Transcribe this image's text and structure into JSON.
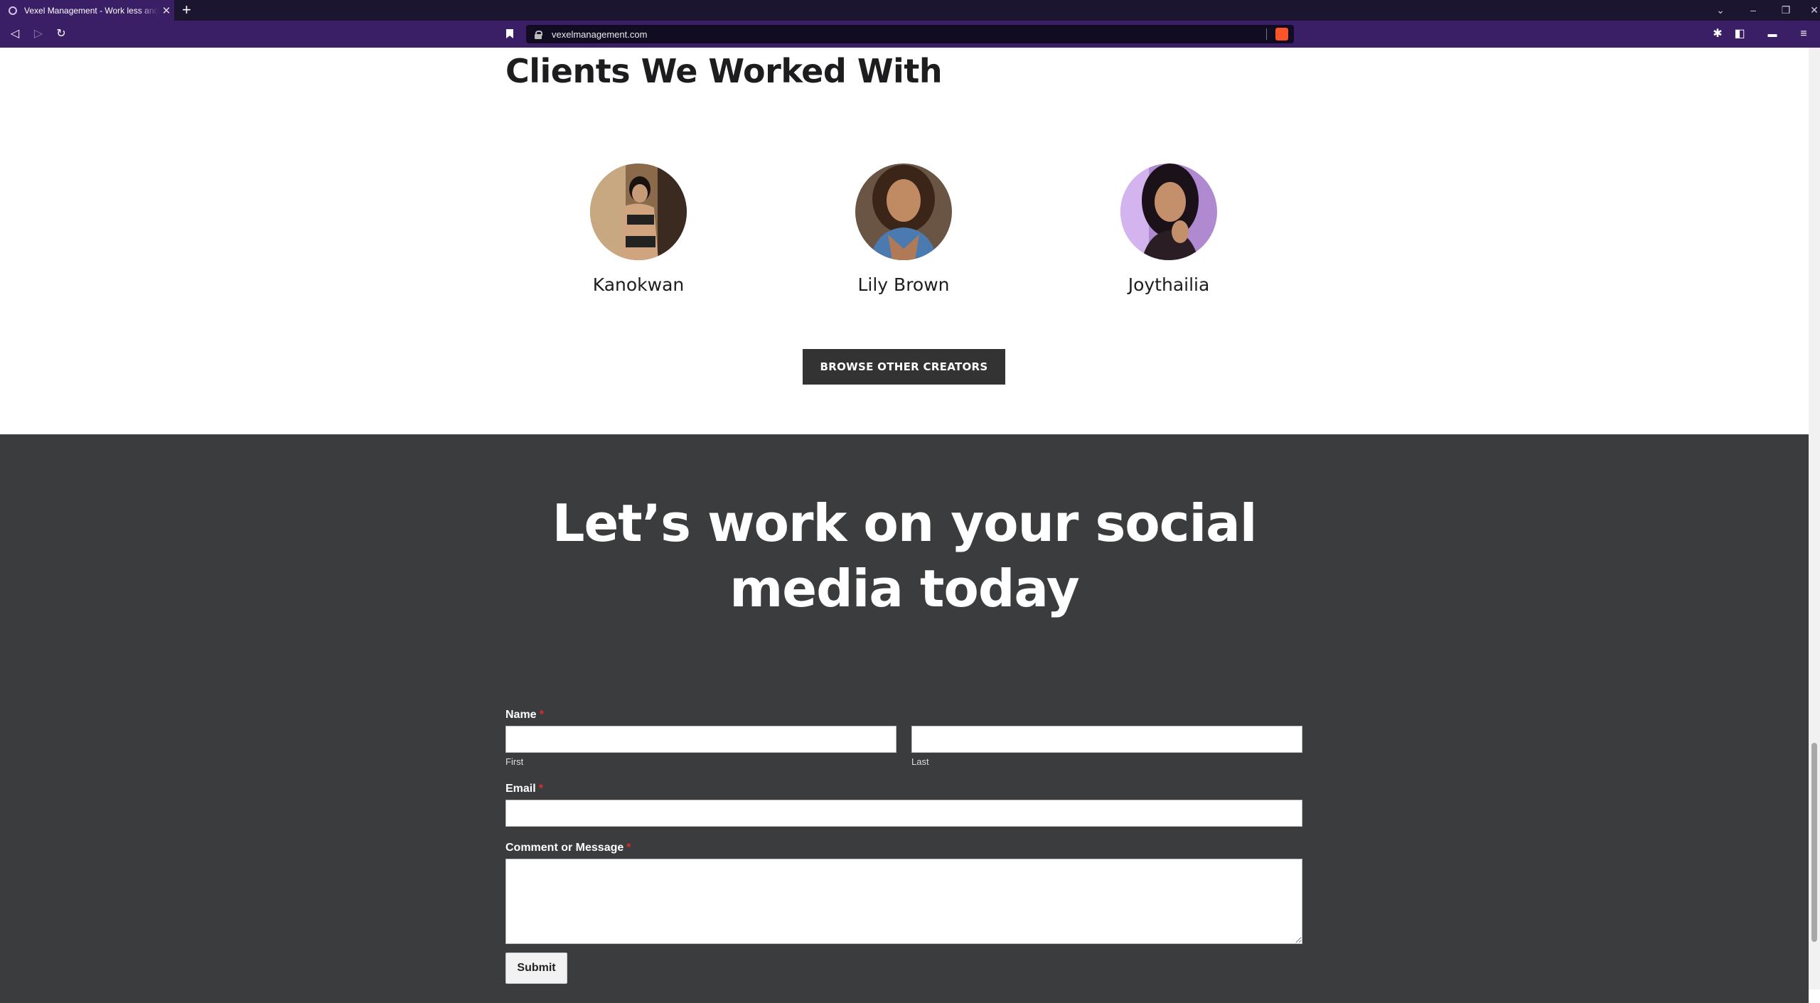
{
  "browser": {
    "tab_title": "Vexel Management - Work less and",
    "url": "vexelmanagement.com"
  },
  "clients": {
    "title": "Clients We Worked With",
    "items": [
      {
        "name": "Kanokwan"
      },
      {
        "name": "Lily Brown"
      },
      {
        "name": "Joythailia"
      }
    ],
    "browse_label": "BROWSE OTHER CREATORS"
  },
  "cta": {
    "line1": "Let’s work on your social",
    "line2": "media today"
  },
  "form": {
    "name_label": "Name",
    "first_sublabel": "First",
    "last_sublabel": "Last",
    "email_label": "Email",
    "message_label": "Comment or Message",
    "required_mark": "*",
    "submit_label": "Submit"
  },
  "colors": {
    "browser_purple": "#3b1f66",
    "dark_section": "#3a3c3d",
    "button_dark": "#333333",
    "required_red": "#e02b2b"
  }
}
